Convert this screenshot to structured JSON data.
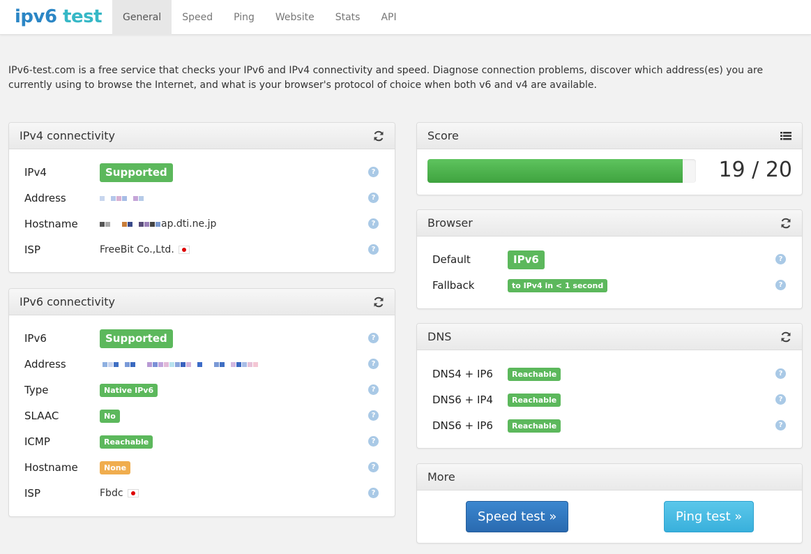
{
  "brand": {
    "part1": "ipv6",
    "part2": " test"
  },
  "nav": [
    "General",
    "Speed",
    "Ping",
    "Website",
    "Stats",
    "API"
  ],
  "intro": "IPv6-test.com is a free service that checks your IPv6 and IPv4 connectivity and speed. Diagnose connection problems, discover which address(es) you are currently using to browse the Internet, and what is your browser's protocol of choice when both v6 and v4 are available.",
  "ipv4": {
    "title": "IPv4 connectivity",
    "rows": [
      {
        "label": "IPv4",
        "value": "Supported"
      },
      {
        "label": "Address",
        "value": ""
      },
      {
        "label": "Hostname",
        "value": "ap.dti.ne.jp"
      },
      {
        "label": "ISP",
        "value": "FreeBit Co.,Ltd."
      }
    ]
  },
  "ipv6": {
    "title": "IPv6 connectivity",
    "rows": [
      {
        "label": "IPv6",
        "value": "Supported"
      },
      {
        "label": "Address",
        "value": ""
      },
      {
        "label": "Type",
        "value": "Native IPv6"
      },
      {
        "label": "SLAAC",
        "value": "No"
      },
      {
        "label": "ICMP",
        "value": "Reachable"
      },
      {
        "label": "Hostname",
        "value": "None"
      },
      {
        "label": "ISP",
        "value": "Fbdc"
      }
    ]
  },
  "score": {
    "title": "Score",
    "value": 19,
    "max": 20,
    "text": "19 / 20",
    "progress": 0.95
  },
  "browser": {
    "title": "Browser",
    "rows": [
      {
        "label": "Default",
        "value": "IPv6"
      },
      {
        "label": "Fallback",
        "value": "to IPv4 in < 1 second"
      }
    ]
  },
  "dns": {
    "title": "DNS",
    "rows": [
      {
        "label": "DNS4 + IP6",
        "value": "Reachable"
      },
      {
        "label": "DNS6 + IP4",
        "value": "Reachable"
      },
      {
        "label": "DNS6 + IP6",
        "value": "Reachable"
      }
    ]
  },
  "more": {
    "title": "More",
    "speed_button": "Speed test »",
    "ping_button": "Ping test »"
  },
  "help_glyph": "?",
  "icons": {
    "refresh": "refresh-icon",
    "list": "list-icon",
    "help": "help-icon",
    "flag": "japan-flag-icon"
  },
  "colors": {
    "success": "#5cb85c",
    "warning": "#f0ad4e",
    "primary": "#2a6ab0",
    "info": "#39b0dc",
    "brand1": "#2b86c5",
    "brand2": "#36b8c6"
  }
}
